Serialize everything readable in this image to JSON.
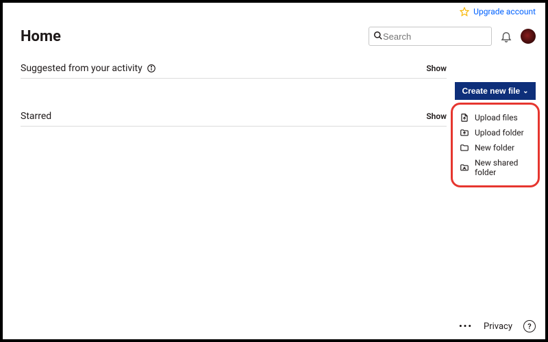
{
  "topbar": {
    "upgrade_label": "Upgrade account"
  },
  "header": {
    "title": "Home"
  },
  "search": {
    "placeholder": "Search"
  },
  "sections": {
    "suggested": {
      "title": "Suggested from your activity",
      "show_label": "Show"
    },
    "starred": {
      "title": "Starred",
      "show_label": "Show"
    }
  },
  "create_button": {
    "label": "Create new file"
  },
  "create_menu": {
    "items": [
      {
        "label": "Upload files"
      },
      {
        "label": "Upload folder"
      },
      {
        "label": "New folder"
      },
      {
        "label": "New shared folder"
      }
    ]
  },
  "footer": {
    "privacy_label": "Privacy",
    "help_glyph": "?"
  }
}
